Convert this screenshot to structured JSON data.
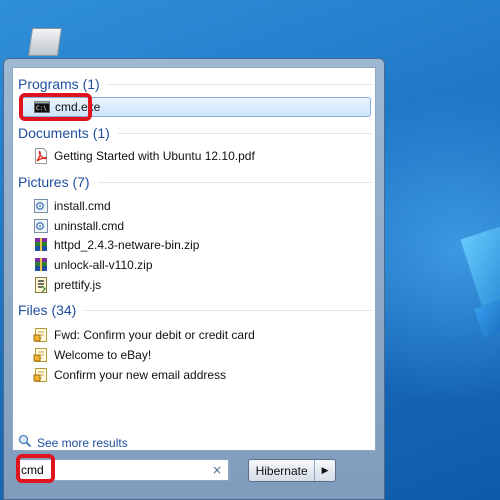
{
  "start_menu": {
    "sections": [
      {
        "header": "Programs (1)",
        "items": [
          {
            "label": "cmd.exe",
            "icon": "console-icon"
          }
        ]
      },
      {
        "header": "Documents (1)",
        "items": [
          {
            "label": "Getting Started with Ubuntu 12.10.pdf",
            "icon": "pdf-icon"
          }
        ]
      },
      {
        "header": "Pictures (7)",
        "items": [
          {
            "label": "install.cmd",
            "icon": "script-icon"
          },
          {
            "label": "uninstall.cmd",
            "icon": "script-icon"
          },
          {
            "label": "httpd_2.4.3-netware-bin.zip",
            "icon": "archive-icon"
          },
          {
            "label": "unlock-all-v110.zip",
            "icon": "archive-icon"
          },
          {
            "label": "prettify.js",
            "icon": "js-file-icon"
          }
        ]
      },
      {
        "header": "Files (34)",
        "items": [
          {
            "label": "Fwd: Confirm your debit or credit card",
            "icon": "email-icon"
          },
          {
            "label": "Welcome to eBay!",
            "icon": "email-icon"
          },
          {
            "label": "Confirm your new email address",
            "icon": "email-icon"
          }
        ]
      }
    ],
    "see_more": "See more results",
    "search": {
      "value": "cmd",
      "clear": "×"
    },
    "power": {
      "label": "Hibernate",
      "arrow": "▶"
    }
  },
  "colors": {
    "header_text": "#1f4e9e",
    "highlight": "#e0141e",
    "selection": "#cfe4fb"
  }
}
